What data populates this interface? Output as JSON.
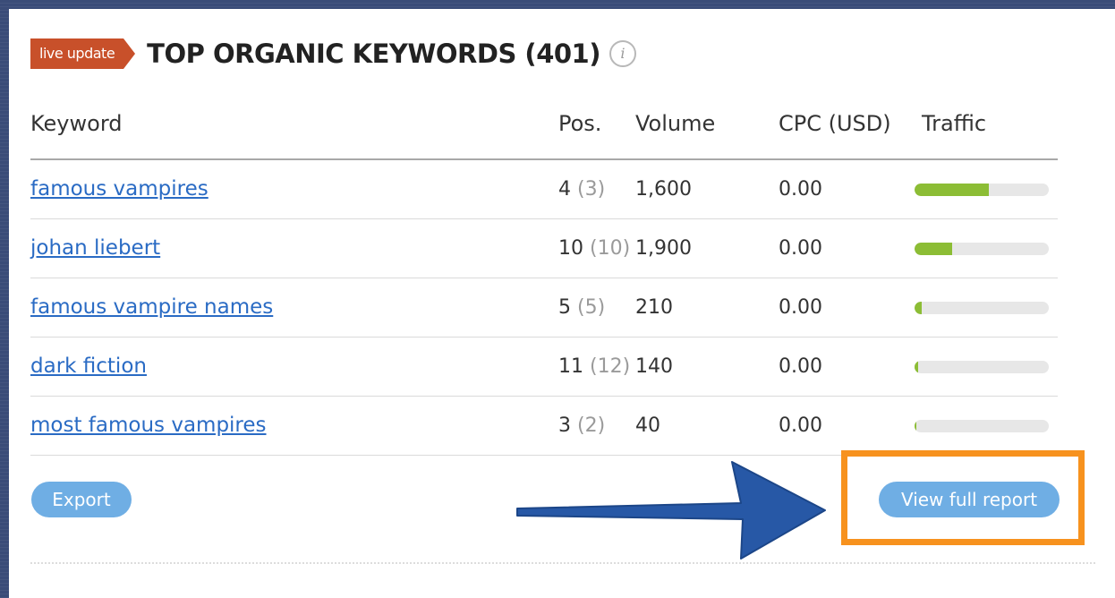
{
  "header": {
    "badge_label": "live update",
    "title": "TOP ORGANIC KEYWORDS (401)",
    "info_glyph": "i"
  },
  "table": {
    "columns": {
      "keyword": "Keyword",
      "pos": "Pos.",
      "volume": "Volume",
      "cpc": "CPC (USD)",
      "traffic": "Traffic"
    },
    "rows": [
      {
        "keyword": "famous vampires",
        "pos": "4",
        "prev_pos": "(3)",
        "volume": "1,600",
        "cpc": "0.00",
        "traffic_fraction": 0.55
      },
      {
        "keyword": "johan liebert",
        "pos": "10",
        "prev_pos": "(10)",
        "volume": "1,900",
        "cpc": "0.00",
        "traffic_fraction": 0.28
      },
      {
        "keyword": "famous vampire names",
        "pos": "5",
        "prev_pos": "(5)",
        "volume": "210",
        "cpc": "0.00",
        "traffic_fraction": 0.05
      },
      {
        "keyword": "dark fiction",
        "pos": "11",
        "prev_pos": "(12)",
        "volume": "140",
        "cpc": "0.00",
        "traffic_fraction": 0.025
      },
      {
        "keyword": "most famous vampires",
        "pos": "3",
        "prev_pos": "(2)",
        "volume": "40",
        "cpc": "0.00",
        "traffic_fraction": 0.012
      }
    ]
  },
  "actions": {
    "export_label": "Export",
    "view_full_report_label": "View full report"
  },
  "colors": {
    "badge": "#c8502a",
    "link": "#2a6bc4",
    "traffic_fill": "#8cbd35",
    "button": "#6faee4",
    "highlight": "#f7921e",
    "arrow": "#2758a6"
  },
  "icons": {
    "info": "info-icon",
    "annotation_arrow": "arrow-right-icon"
  }
}
